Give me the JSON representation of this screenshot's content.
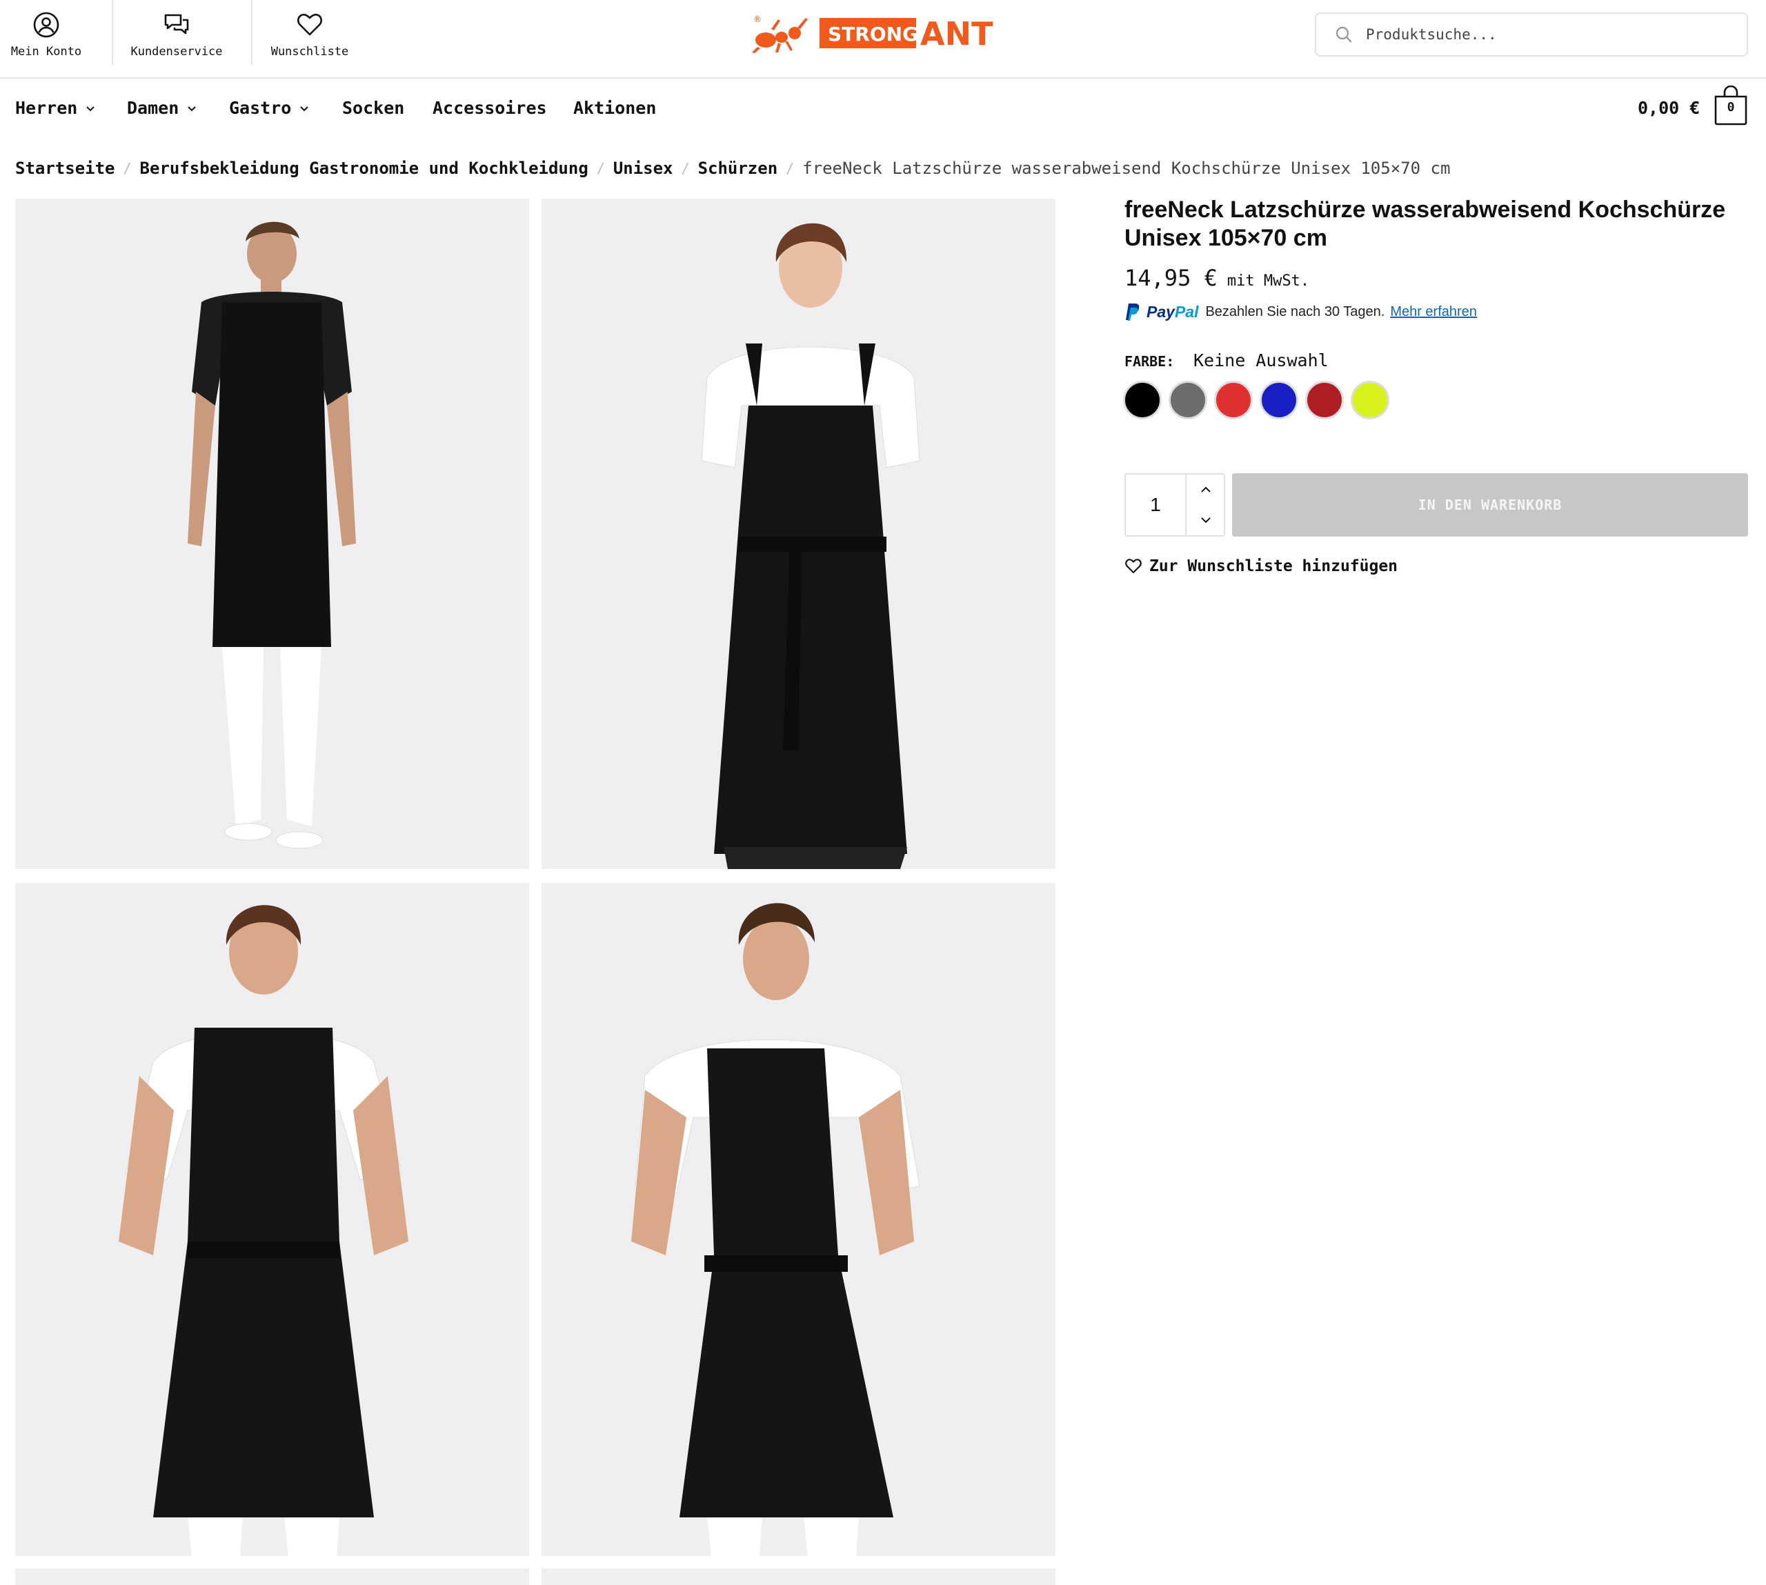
{
  "header": {
    "utility": [
      {
        "label": "Mein Konto",
        "icon": "user-circle-icon"
      },
      {
        "label": "Kundenservice",
        "icon": "chat-bubbles-icon"
      },
      {
        "label": "Wunschliste",
        "icon": "heart-icon"
      }
    ],
    "logo_text": {
      "left": "STRONG",
      "right": "ANT",
      "mark": "®"
    },
    "search": {
      "placeholder": "Produktsuche..."
    }
  },
  "nav": {
    "items": [
      {
        "label": "Herren",
        "has_dropdown": true
      },
      {
        "label": "Damen",
        "has_dropdown": true
      },
      {
        "label": "Gastro",
        "has_dropdown": true
      },
      {
        "label": "Socken",
        "has_dropdown": false
      },
      {
        "label": "Accessoires",
        "has_dropdown": false
      },
      {
        "label": "Aktionen",
        "has_dropdown": false
      }
    ],
    "cart_total": "0,00 €",
    "cart_count": "0"
  },
  "breadcrumb": {
    "links": [
      "Startseite",
      "Berufsbekleidung Gastronomie und Kochkleidung",
      "Unisex",
      "Schürzen"
    ],
    "separator": "/",
    "current": "freeNeck Latzschürze wasserabweisend Kochschürze Unisex 105×70 cm"
  },
  "product": {
    "title": "freeNeck Latzschürze wasserabweisend Kochschürze Unisex 105×70 cm",
    "price": "14,95 €",
    "tax_note": "mit MwSt.",
    "paypal": {
      "brand_a": "Pay",
      "brand_b": "Pal",
      "text": "Bezahlen Sie nach 30 Tagen.",
      "link": "Mehr erfahren"
    },
    "color_label": "FARBE:",
    "color_value": "Keine Auswahl",
    "swatches": [
      "#000000",
      "#6d6d6d",
      "#e03030",
      "#1a1fc4",
      "#b01e24",
      "#d9f21c"
    ],
    "quantity": "1",
    "add_to_cart": "IN DEN WARENKORB",
    "wishlist": "Zur Wunschliste hinzufügen"
  },
  "colors": {
    "brand_orange": "#f25a1c",
    "button_disabled": "#c7c7c7",
    "tile_bg": "#efeff1",
    "paypal_dark": "#003087",
    "paypal_light": "#009cde"
  }
}
